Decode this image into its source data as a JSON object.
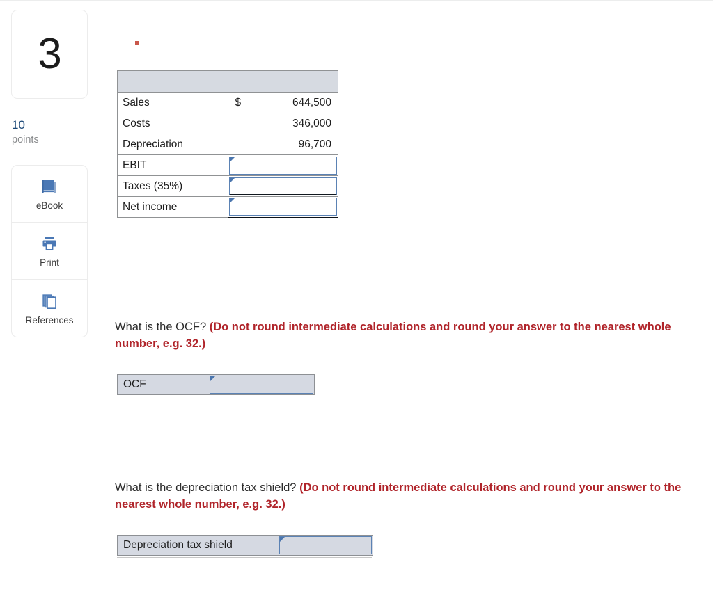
{
  "question": {
    "number": "3",
    "points_value": "10",
    "points_label": "points"
  },
  "tools": [
    {
      "label": "eBook",
      "icon": "ebook-icon"
    },
    {
      "label": "Print",
      "icon": "print-icon"
    },
    {
      "label": "References",
      "icon": "references-icon"
    }
  ],
  "colors": {
    "accent_blue": "#4b76ae",
    "points_blue": "#1b4878",
    "instruction_red": "#b0242a",
    "header_fill": "#d6dae1",
    "answer_fill": "#d5d9e2"
  },
  "fin_table": {
    "header": "",
    "rows": [
      {
        "label": "Sales",
        "symbol": "$",
        "value": "644,500",
        "input": false
      },
      {
        "label": "Costs",
        "symbol": "",
        "value": "346,000",
        "input": false
      },
      {
        "label": "Depreciation",
        "symbol": "",
        "value": "96,700",
        "input": false
      },
      {
        "label": "EBIT",
        "symbol": "",
        "value": "",
        "input": true
      },
      {
        "label": "Taxes (35%)",
        "symbol": "",
        "value": "",
        "input": true
      },
      {
        "label": "Net income",
        "symbol": "",
        "value": "",
        "input": true
      }
    ]
  },
  "questions": [
    {
      "prompt": "What is the OCF? ",
      "instruction": "(Do not round intermediate calculations and round your answer to the nearest whole number, e.g. 32.)",
      "answer_label": "OCF",
      "answer_value": ""
    },
    {
      "prompt": "What is the depreciation tax shield? ",
      "instruction": "(Do not round intermediate calculations and round your answer to the nearest whole number, e.g. 32.)",
      "answer_label": "Depreciation tax shield",
      "answer_value": ""
    }
  ]
}
